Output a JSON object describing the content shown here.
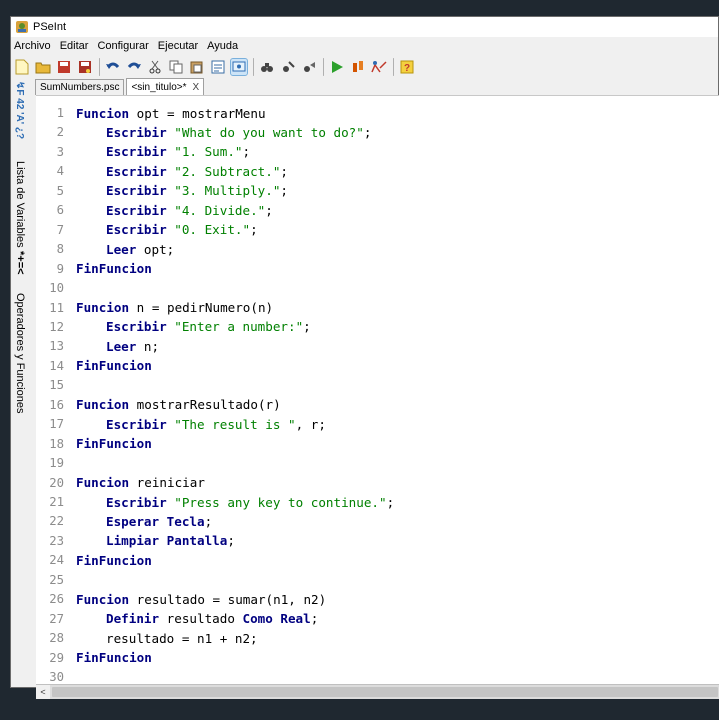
{
  "window": {
    "title": "PSeInt"
  },
  "menu": [
    "Archivo",
    "Editar",
    "Configurar",
    "Ejecutar",
    "Ayuda"
  ],
  "toolbar_icons": [
    "new-file-icon",
    "open-file-icon",
    "save-icon",
    "save-as-icon",
    "undo-icon",
    "redo-icon",
    "cut-icon",
    "copy-icon",
    "paste-icon",
    "edit-icon",
    "view-icon",
    "search-icon",
    "find-next-icon",
    "replace-icon",
    "run-icon",
    "step-icon",
    "diagram-icon",
    "help-icon"
  ],
  "sidebar": {
    "vars_icon_text": "↯F 42 'A' ¿?",
    "vars_label": "Lista de Variables",
    "ops_icon_text": "*+=<",
    "ops_label": "Operadores y Funciones"
  },
  "tabs": [
    {
      "label": "SumNumbers.psc",
      "active": false,
      "closable": false
    },
    {
      "label": "<sin_titulo>*",
      "active": true,
      "closable": true
    }
  ],
  "tab_close_glyph": "X",
  "code_lines": [
    {
      "n": "1",
      "indent": 0,
      "tokens": [
        [
          "kw",
          "Funcion"
        ],
        [
          "t",
          " opt = mostrarMenu"
        ]
      ]
    },
    {
      "n": "2",
      "indent": 1,
      "tokens": [
        [
          "kw",
          "Escribir"
        ],
        [
          "t",
          " "
        ],
        [
          "str",
          "\"What do you want to do?\""
        ],
        [
          "t",
          ";"
        ]
      ]
    },
    {
      "n": "3",
      "indent": 1,
      "tokens": [
        [
          "kw",
          "Escribir"
        ],
        [
          "t",
          " "
        ],
        [
          "str",
          "\"1. Sum.\""
        ],
        [
          "t",
          ";"
        ]
      ]
    },
    {
      "n": "4",
      "indent": 1,
      "tokens": [
        [
          "kw",
          "Escribir"
        ],
        [
          "t",
          " "
        ],
        [
          "str",
          "\"2. Subtract.\""
        ],
        [
          "t",
          ";"
        ]
      ]
    },
    {
      "n": "5",
      "indent": 1,
      "tokens": [
        [
          "kw",
          "Escribir"
        ],
        [
          "t",
          " "
        ],
        [
          "str",
          "\"3. Multiply.\""
        ],
        [
          "t",
          ";"
        ]
      ]
    },
    {
      "n": "6",
      "indent": 1,
      "tokens": [
        [
          "kw",
          "Escribir"
        ],
        [
          "t",
          " "
        ],
        [
          "str",
          "\"4. Divide.\""
        ],
        [
          "t",
          ";"
        ]
      ]
    },
    {
      "n": "7",
      "indent": 1,
      "tokens": [
        [
          "kw",
          "Escribir"
        ],
        [
          "t",
          " "
        ],
        [
          "str",
          "\"0. Exit.\""
        ],
        [
          "t",
          ";"
        ]
      ]
    },
    {
      "n": "8",
      "indent": 1,
      "tokens": [
        [
          "kw",
          "Leer"
        ],
        [
          "t",
          " opt;"
        ]
      ]
    },
    {
      "n": "9",
      "indent": 0,
      "tokens": [
        [
          "kw",
          "FinFuncion"
        ]
      ]
    },
    {
      "n": "10",
      "indent": 0,
      "tokens": []
    },
    {
      "n": "11",
      "indent": 0,
      "tokens": [
        [
          "kw",
          "Funcion"
        ],
        [
          "t",
          " n = pedirNumero(n)"
        ]
      ]
    },
    {
      "n": "12",
      "indent": 1,
      "tokens": [
        [
          "kw",
          "Escribir"
        ],
        [
          "t",
          " "
        ],
        [
          "str",
          "\"Enter a number:\""
        ],
        [
          "t",
          ";"
        ]
      ]
    },
    {
      "n": "13",
      "indent": 1,
      "tokens": [
        [
          "kw",
          "Leer"
        ],
        [
          "t",
          " n;"
        ]
      ]
    },
    {
      "n": "14",
      "indent": 0,
      "tokens": [
        [
          "kw",
          "FinFuncion"
        ]
      ]
    },
    {
      "n": "15",
      "indent": 0,
      "tokens": []
    },
    {
      "n": "16",
      "indent": 0,
      "tokens": [
        [
          "kw",
          "Funcion"
        ],
        [
          "t",
          " mostrarResultado(r)"
        ]
      ]
    },
    {
      "n": "17",
      "indent": 1,
      "tokens": [
        [
          "kw",
          "Escribir"
        ],
        [
          "t",
          " "
        ],
        [
          "str",
          "\"The result is \""
        ],
        [
          "t",
          ", r;"
        ]
      ]
    },
    {
      "n": "18",
      "indent": 0,
      "tokens": [
        [
          "kw",
          "FinFuncion"
        ]
      ]
    },
    {
      "n": "19",
      "indent": 0,
      "tokens": []
    },
    {
      "n": "20",
      "indent": 0,
      "tokens": [
        [
          "kw",
          "Funcion"
        ],
        [
          "t",
          " reiniciar"
        ]
      ]
    },
    {
      "n": "21",
      "indent": 1,
      "tokens": [
        [
          "kw",
          "Escribir"
        ],
        [
          "t",
          " "
        ],
        [
          "str",
          "\"Press any key to continue.\""
        ],
        [
          "t",
          ";"
        ]
      ]
    },
    {
      "n": "22",
      "indent": 1,
      "tokens": [
        [
          "kw",
          "Esperar Tecla"
        ],
        [
          "t",
          ";"
        ]
      ]
    },
    {
      "n": "23",
      "indent": 1,
      "tokens": [
        [
          "kw",
          "Limpiar Pantalla"
        ],
        [
          "t",
          ";"
        ]
      ]
    },
    {
      "n": "24",
      "indent": 0,
      "tokens": [
        [
          "kw",
          "FinFuncion"
        ]
      ]
    },
    {
      "n": "25",
      "indent": 0,
      "tokens": []
    },
    {
      "n": "26",
      "indent": 0,
      "tokens": [
        [
          "kw",
          "Funcion"
        ],
        [
          "t",
          " resultado = sumar(n1, n2)"
        ]
      ]
    },
    {
      "n": "27",
      "indent": 1,
      "tokens": [
        [
          "kw",
          "Definir"
        ],
        [
          "t",
          " resultado "
        ],
        [
          "kw",
          "Como Real"
        ],
        [
          "t",
          ";"
        ]
      ]
    },
    {
      "n": "28",
      "indent": 1,
      "tokens": [
        [
          "t",
          "resultado = n1 + n2;"
        ]
      ]
    },
    {
      "n": "29",
      "indent": 0,
      "tokens": [
        [
          "kw",
          "FinFuncion"
        ]
      ]
    },
    {
      "n": "30",
      "indent": 0,
      "tokens": []
    }
  ],
  "scroll_arrow": "<",
  "colors": {
    "keyword": "#000080",
    "string": "#008000",
    "line_number": "#8c8c8c",
    "background": "#1f2830"
  }
}
